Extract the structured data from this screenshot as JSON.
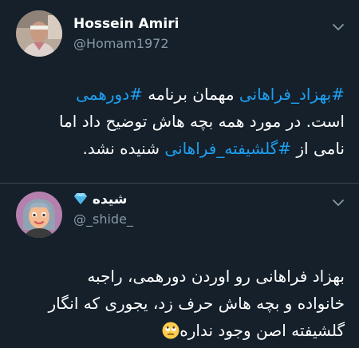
{
  "tweets": [
    {
      "author": {
        "name": "Hossein Amiri",
        "handle": "@Homam1972"
      },
      "body": {
        "line1_hashtag1": "#بهزاد_فراهانی",
        "line1_text": " مهمان برنامه ",
        "line1_hashtag2": "#دورهمی",
        "line2_text": "است. در مورد همه بچه هاش توضیح داد اما",
        "line3_text_before": "نامی از ",
        "line3_hashtag": "#گلشیفته_فراهانی",
        "line3_text_after": " شنیده نشد."
      }
    },
    {
      "author": {
        "name": "شیده",
        "name_icon": "gem-icon",
        "handle": "@_shide_"
      },
      "body": {
        "line1_text": "بهزاد فراهانی رو اوردن دورهمی، راجبه",
        "line2_text": "خانواده و بچه هاش حرف زد، یجوری که انگار",
        "line3_text": "گلشیفته اصن وجود نداره",
        "emoji": "eye-roll-face-icon"
      }
    }
  ],
  "colors": {
    "background": "#15202b",
    "hashtag": "#1da1f2",
    "secondary_text": "#8899a6",
    "divider": "#38444d"
  }
}
